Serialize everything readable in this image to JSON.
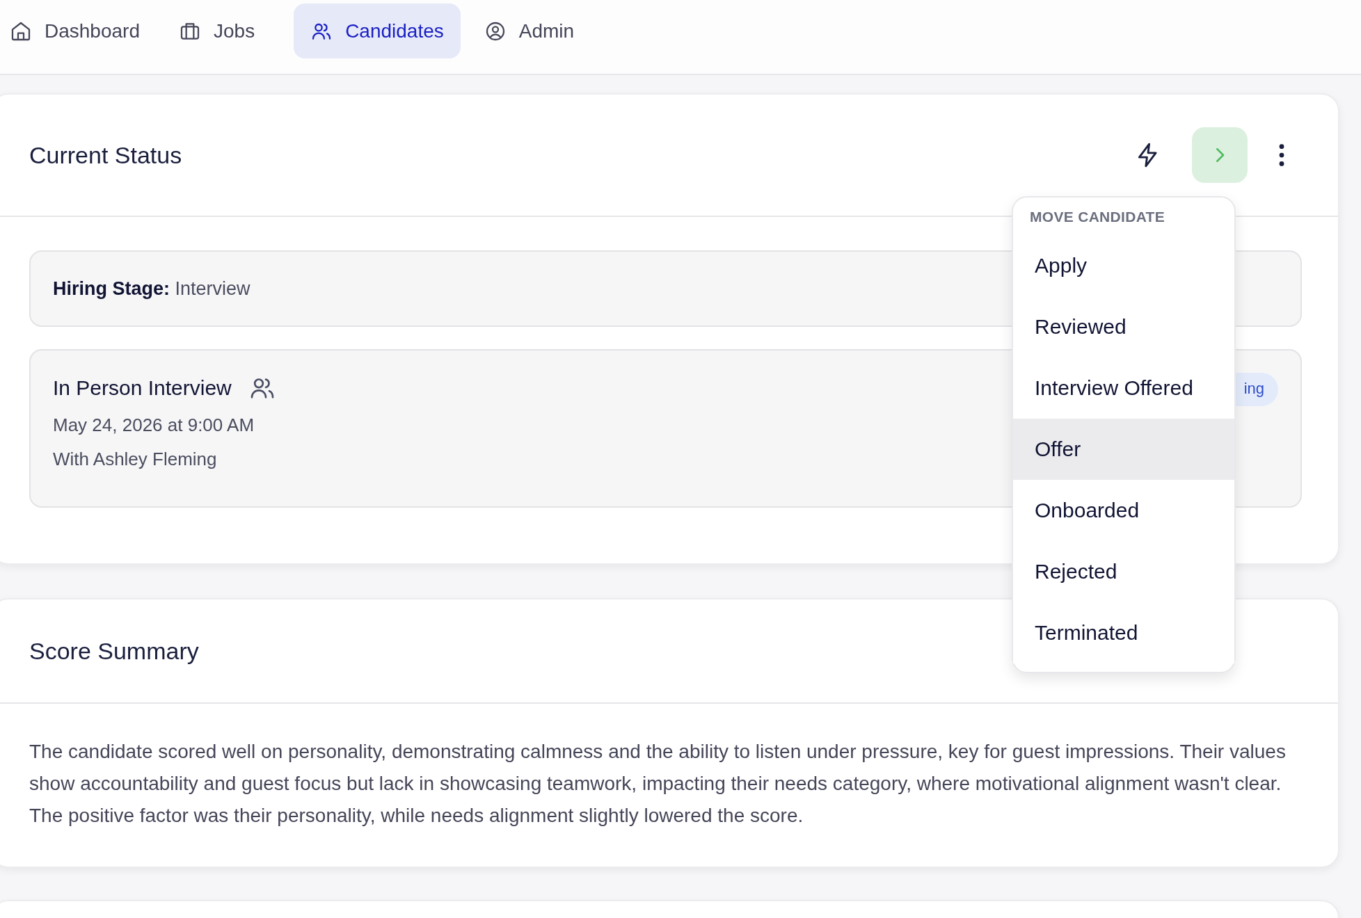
{
  "nav": {
    "tabs": [
      {
        "label": "Dashboard",
        "selected": false
      },
      {
        "label": "Jobs",
        "selected": false
      },
      {
        "label": "Candidates",
        "selected": true
      },
      {
        "label": "Admin",
        "selected": false
      }
    ]
  },
  "status_card": {
    "title": "Current Status",
    "hiring_stage": {
      "label": "Hiring Stage:",
      "value": "Interview"
    },
    "interview": {
      "title": "In Person Interview",
      "datetime": "May 24, 2026 at 9:00 AM",
      "interviewer": "With Ashley Fleming",
      "badge": "ing"
    },
    "menu": {
      "heading": "MOVE CANDIDATE",
      "items": [
        {
          "label": "Apply",
          "selected": false
        },
        {
          "label": "Reviewed",
          "selected": false
        },
        {
          "label": "Interview Offered",
          "selected": false
        },
        {
          "label": "Offer",
          "selected": true
        },
        {
          "label": "Onboarded",
          "selected": false
        },
        {
          "label": "Rejected",
          "selected": false
        },
        {
          "label": "Terminated",
          "selected": false
        }
      ]
    }
  },
  "score_card": {
    "title": "Score Summary",
    "text": "The candidate scored well on personality, demonstrating calmness and the ability to listen under pressure, key for guest impressions. Their values show accountability and guest focus but lack in showcasing teamwork, impacting their needs category, where motivational alignment wasn't clear. The positive factor was their personality, while needs alignment slightly lowered the score."
  }
}
